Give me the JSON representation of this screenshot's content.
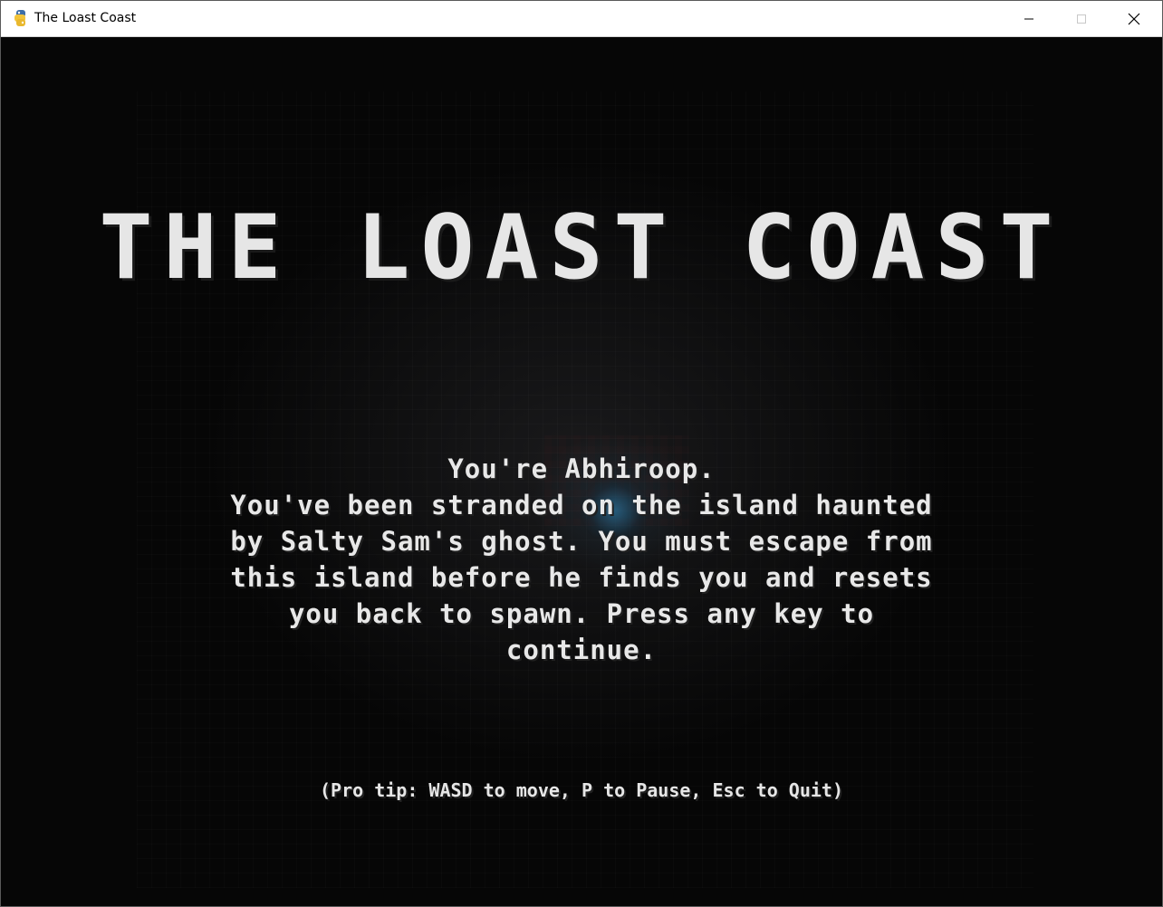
{
  "window": {
    "title": "The Loast Coast",
    "app_icon": "python-snake-icon",
    "controls": {
      "minimize": "minimize-icon",
      "maximize": "maximize-icon",
      "close": "close-icon"
    }
  },
  "game": {
    "title": "THE LOAST COAST",
    "story_lines": [
      "You're Abhiroop.",
      "You've been stranded on the island haunted",
      "by Salty Sam's ghost. You must escape from",
      "this island before he finds you and resets",
      "you back to spawn. Press any key to",
      "continue."
    ],
    "pro_tip": "(Pro tip: WASD to move, P to Pause, Esc to Quit)"
  },
  "colors": {
    "text": "#e6e6e6",
    "background": "#050505",
    "titlebar": "#ffffff"
  }
}
